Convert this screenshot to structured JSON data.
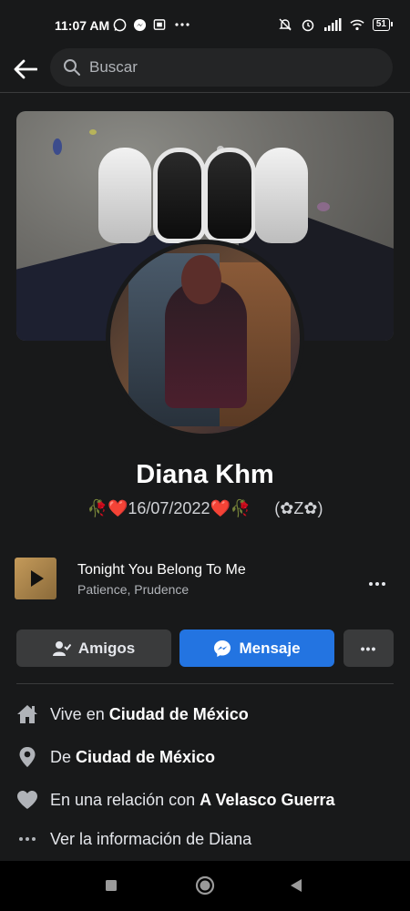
{
  "status_bar": {
    "time": "11:07 AM",
    "battery": "51",
    "left_icons": [
      "whatsapp-icon",
      "messenger-icon",
      "sim-icon",
      "more-dots-icon"
    ],
    "right_icons": [
      "mute-icon",
      "alarm-icon",
      "signal-icon",
      "wifi-icon",
      "battery-icon"
    ]
  },
  "search": {
    "placeholder": "Buscar"
  },
  "profile": {
    "name": "Diana Khm",
    "bio_main": "🥀❤️16/07/2022❤️🥀",
    "bio_tag": "(✿Z✿)"
  },
  "song": {
    "title": "Tonight You Belong To Me",
    "artist": "Patience, Prudence"
  },
  "actions": {
    "friends_label": "Amigos",
    "message_label": "Mensaje",
    "more_label": "•••"
  },
  "details": [
    {
      "icon": "home-icon",
      "prefix": "Vive en ",
      "bold": "Ciudad de México"
    },
    {
      "icon": "location-pin-icon",
      "prefix": "De ",
      "bold": "Ciudad de México"
    },
    {
      "icon": "heart-icon",
      "prefix": "En una relación con ",
      "bold": "A Velasco Guerra"
    },
    {
      "icon": "more-dots-icon",
      "prefix": "Ver la información de Diana",
      "bold": ""
    }
  ],
  "colors": {
    "background": "#18191a",
    "primary_button": "#2374e1",
    "secondary_button": "#3a3b3c"
  }
}
